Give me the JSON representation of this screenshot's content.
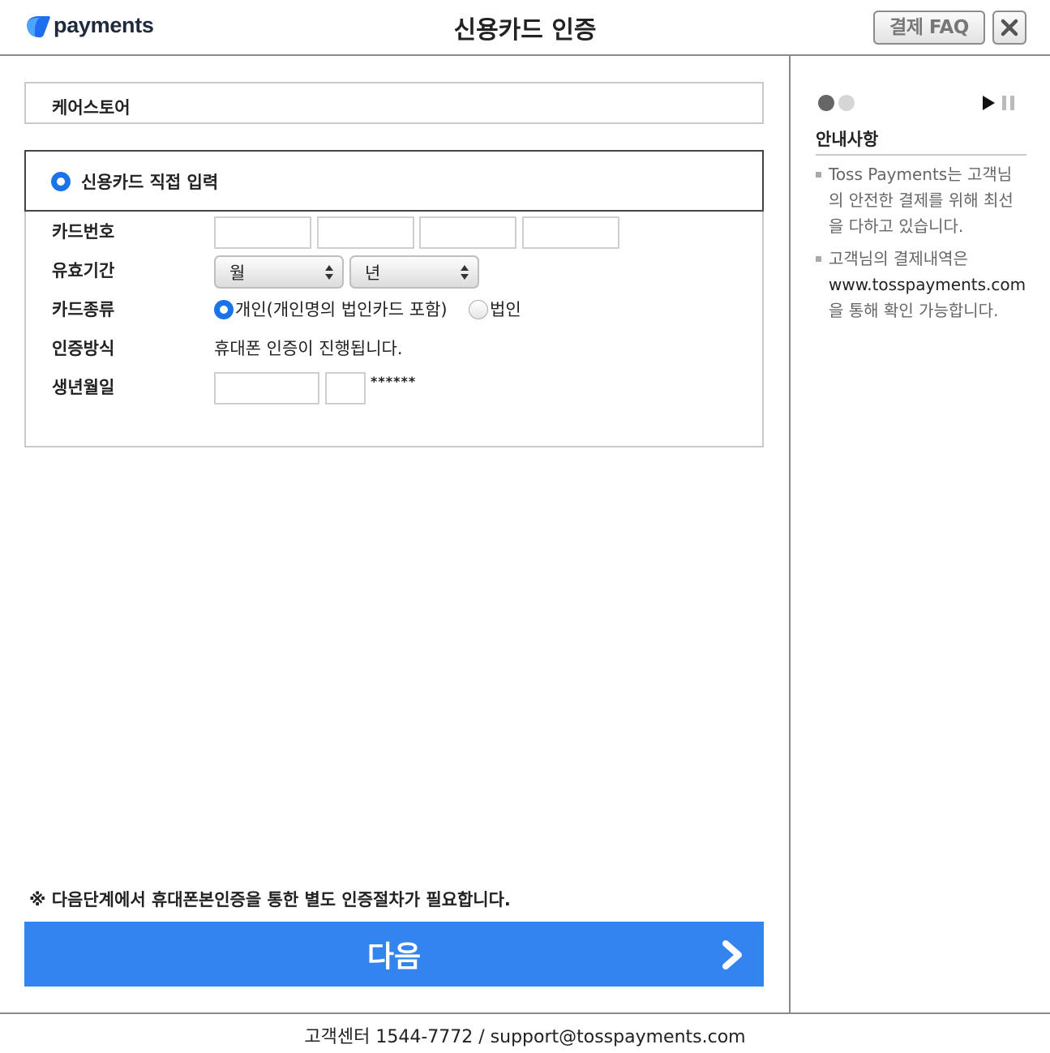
{
  "header": {
    "logo_text": "payments",
    "title": "신용카드 인증",
    "faq_label": "결제 FAQ"
  },
  "merchant": {
    "name": "케어스토어"
  },
  "form": {
    "method_label": "신용카드 직접 입력",
    "card_number_label": "카드번호",
    "expiry_label": "유효기간",
    "month_value": "월",
    "year_value": "년",
    "card_type_label": "카드종류",
    "card_type_personal": "개인(개인명의 법인카드 포함)",
    "card_type_corporate": "법인",
    "auth_method_label": "인증방식",
    "auth_method_value": "휴대폰 인증이 진행됩니다.",
    "birth_label": "생년월일",
    "birth_mask": "******"
  },
  "notice": "※ 다음단계에서 휴대폰본인증을 통한 별도 인증절차가 필요합니다.",
  "next_button": "다음",
  "sidebar": {
    "title": "안내사항",
    "items": [
      {
        "text": "Toss Payments는 고객님의 안전한 결제를 위해 최선을 다하고 있습니다."
      },
      {
        "text_before": "고객님의 결제내역은 ",
        "link": "www.tosspayments.com",
        "text_after": " 을 통해 확인 가능합니다."
      }
    ]
  },
  "footer": "고객센터 1544-7772 / support@tosspayments.com",
  "colors": {
    "primary": "#3484f0",
    "radio": "#1a73e8"
  }
}
